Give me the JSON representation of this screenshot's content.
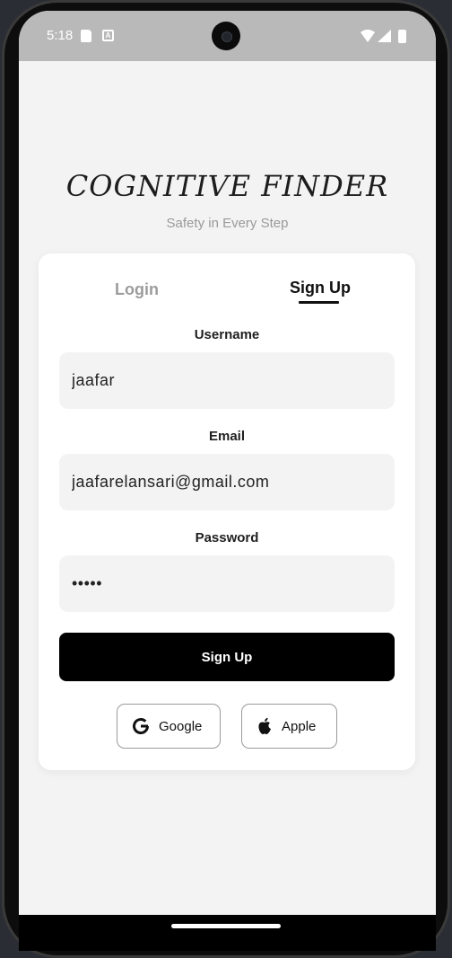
{
  "status_bar": {
    "time": "5:18"
  },
  "app": {
    "title": "COGNITIVE FINDER",
    "subtitle": "Safety in Every Step"
  },
  "tabs": [
    {
      "label": "Login",
      "active": false
    },
    {
      "label": "Sign Up",
      "active": true
    }
  ],
  "form": {
    "username": {
      "label": "Username",
      "value": "jaafar"
    },
    "email": {
      "label": "Email",
      "value": "jaafarelansari@gmail.com"
    },
    "password": {
      "label": "Password",
      "value": "•••••"
    },
    "submit_label": "Sign Up"
  },
  "social": {
    "google_label": "Google",
    "apple_label": "Apple"
  },
  "colors": {
    "accent": "#000000",
    "field_bg": "#f3f3f3",
    "page_bg": "#f3f3f3"
  },
  "icons": [
    "sd-card-icon",
    "a-icon",
    "wifi-icon",
    "signal-icon",
    "battery-icon",
    "google-icon",
    "apple-icon"
  ]
}
